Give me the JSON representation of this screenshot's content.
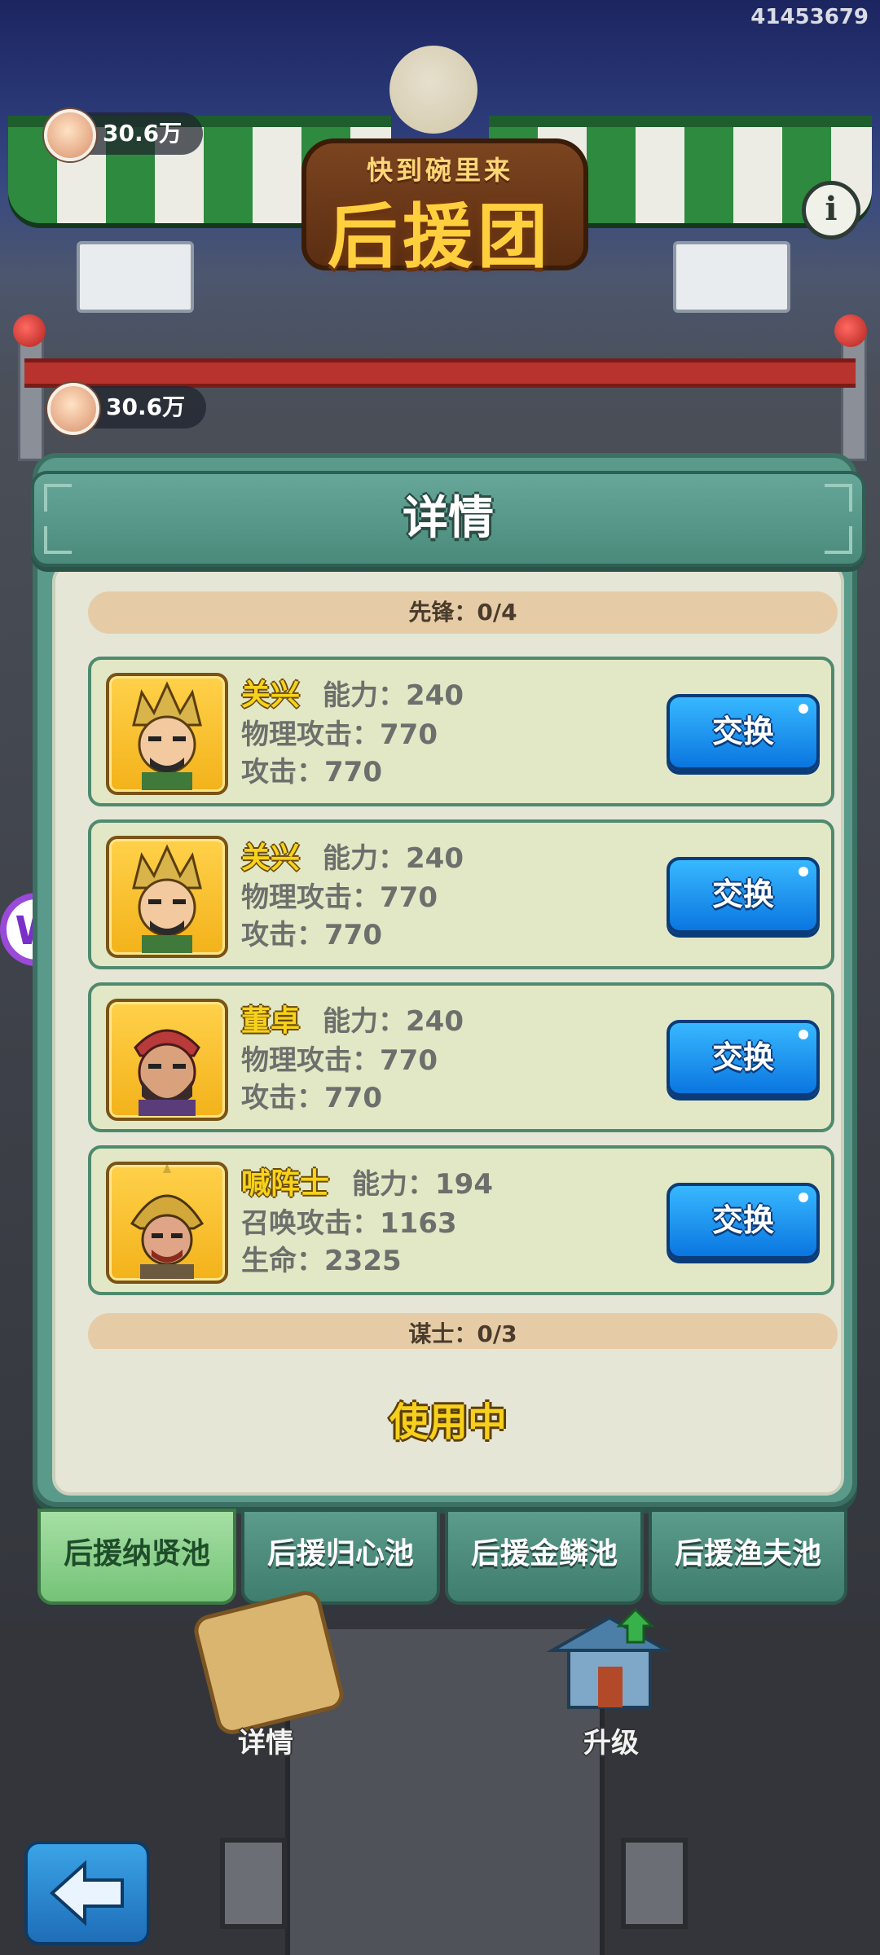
{
  "header": {
    "id_text": "41453679",
    "coins_top": "30.6万",
    "coins_second": "30.6万",
    "logo_subtitle": "快到碗里来",
    "logo_title": "后援团"
  },
  "modal": {
    "title": "详情",
    "section_vanguard": "先锋：0/4",
    "section_strategist": "谋士：0/3",
    "status": "使用中",
    "cards": [
      {
        "name": "关兴",
        "ability": "能力：240",
        "stat1": "物理攻击：770",
        "stat2": "攻击：770",
        "button": "交换"
      },
      {
        "name": "关兴",
        "ability": "能力：240",
        "stat1": "物理攻击：770",
        "stat2": "攻击：770",
        "button": "交换"
      },
      {
        "name": "董卓",
        "ability": "能力：240",
        "stat1": "物理攻击：770",
        "stat2": "攻击：770",
        "button": "交换"
      },
      {
        "name": "喊阵士",
        "ability": "能力：194",
        "stat1": "召唤攻击：1163",
        "stat2": "生命：2325",
        "button": "交换"
      }
    ]
  },
  "tabs": [
    {
      "label": "后援纳贤池",
      "active": true
    },
    {
      "label": "后援归心池",
      "active": false
    },
    {
      "label": "后援金鳞池",
      "active": false
    },
    {
      "label": "后援渔夫池",
      "active": false
    }
  ],
  "scene": {
    "details_label": "详情",
    "upgrade_label": "升级"
  },
  "colors": {
    "accent_teal": "#4a8a7b",
    "button_blue": "#0a76e0",
    "name_yellow": "#f7d21b",
    "active_tab_green": "#74c377"
  }
}
